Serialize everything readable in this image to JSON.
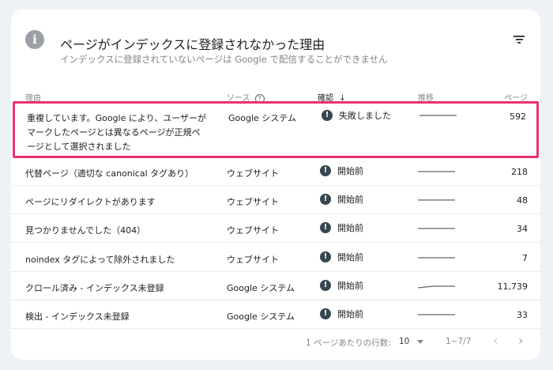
{
  "header": {
    "title": "ページがインデックスに登録されなかった理由",
    "subtitle": "インデックスに登録されていないページは Google で配信することができません"
  },
  "columns": {
    "reason": "理由",
    "source": "ソース",
    "help": "?",
    "validation": "確認",
    "sort_arrow": "↓",
    "trend": "推移",
    "pages": "ページ"
  },
  "rows": [
    {
      "reason": "重複しています。Google により、ユーザーがマークしたページとは異なるページが正規ページとして選択されました",
      "source": "Google システム",
      "status": "失敗しました",
      "pages": "592",
      "highlighted": true
    },
    {
      "reason": "代替ページ（適切な canonical タグあり）",
      "source": "ウェブサイト",
      "status": "開始前",
      "pages": "218"
    },
    {
      "reason": "ページにリダイレクトがあります",
      "source": "ウェブサイト",
      "status": "開始前",
      "pages": "48"
    },
    {
      "reason": "見つかりませんでした（404）",
      "source": "ウェブサイト",
      "status": "開始前",
      "pages": "34"
    },
    {
      "reason": "noindex タグによって除外されました",
      "source": "ウェブサイト",
      "status": "開始前",
      "pages": "7"
    },
    {
      "reason": "クロール済み - インデックス未登録",
      "source": "Google システム",
      "status": "開始前",
      "pages": "11,739"
    },
    {
      "reason": "検出 - インデックス未登録",
      "source": "Google システム",
      "status": "開始前",
      "pages": "33"
    }
  ],
  "footer": {
    "rows_per_page_label": "1 ページあたりの行数:",
    "rows_per_page": "10",
    "range": "1~7/7",
    "prev": "‹",
    "next": "›"
  },
  "colors": {
    "highlight": "#e8336d",
    "status_icon": "#37474f"
  }
}
